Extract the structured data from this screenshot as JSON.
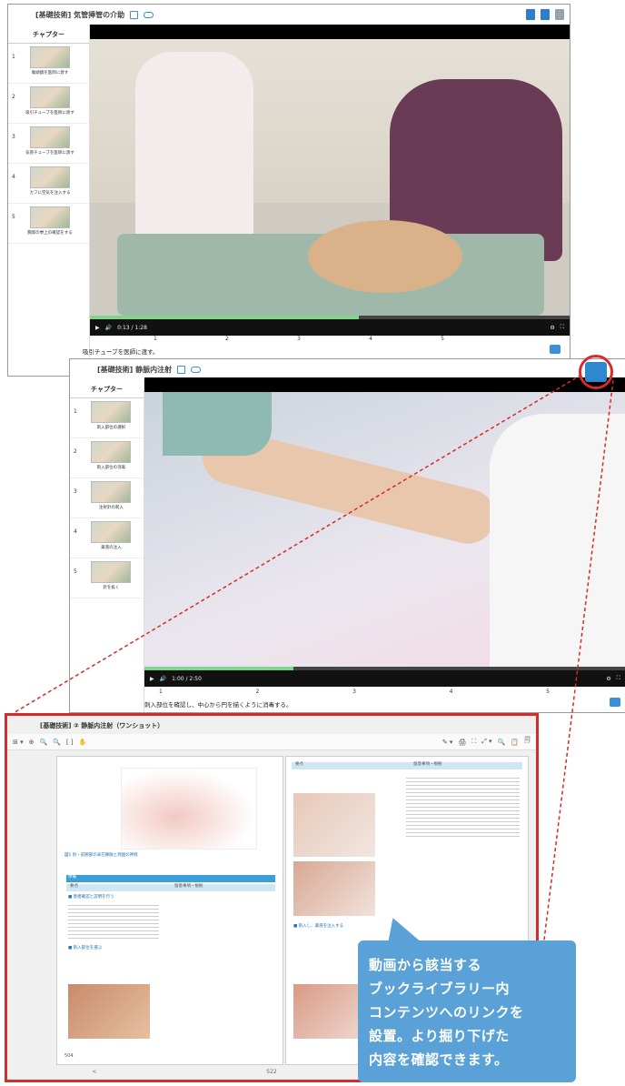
{
  "window1": {
    "title": "[基礎技術] 気管挿管の介助",
    "chapter_header": "チャプター",
    "chapters": [
      {
        "num": "1",
        "label": "喉頭鏡を医師に渡す"
      },
      {
        "num": "2",
        "label": "吸引チューブを医師に渡す"
      },
      {
        "num": "3",
        "label": "気管チューブを医師に渡す"
      },
      {
        "num": "4",
        "label": "カフに空気を注入する"
      },
      {
        "num": "5",
        "label": "胸郭の挙上の確認をする"
      }
    ],
    "time": "0:13 / 1:28",
    "ticks": [
      "1",
      "2",
      "3",
      "4",
      "5"
    ],
    "caption": "吸引チューブを医師に渡す。",
    "progress": 0.56
  },
  "window2": {
    "title": "[基礎技術] 静脈内注射",
    "chapter_header": "チャプター",
    "chapters": [
      {
        "num": "1",
        "label": "刺入部位の選択"
      },
      {
        "num": "2",
        "label": "刺入部位の消毒"
      },
      {
        "num": "3",
        "label": "注射針の刺入"
      },
      {
        "num": "4",
        "label": "薬液の注入"
      },
      {
        "num": "5",
        "label": "針を抜く"
      }
    ],
    "time": "1:00 / 2:50",
    "ticks": [
      "1",
      "2",
      "3",
      "4",
      "5"
    ],
    "caption": "刺入部位を確認し、中心から円を描くように消毒する。",
    "progress": 0.31
  },
  "doc": {
    "title": "[基礎技術] ② 静脈内注射（ワンショット）",
    "toolbar_left": [
      "⊞ ▾",
      "⊕",
      "🔍",
      "🔍",
      "[ ]",
      "✋"
    ],
    "toolbar_right": [
      "✎ ▾",
      "🖨",
      "⛶",
      "⤢ ▾",
      "🔍",
      "📋",
      "🗐"
    ],
    "left_page_number": "504",
    "left_figure_caption": "図1 肘・前腕部の表在静脈と周囲の神経",
    "left_section_heading": "準備",
    "left_table_headers": [
      "要点",
      "留意事項・根拠"
    ],
    "left_steps": [
      "■ 患者確認と説明を行う",
      "■ 刺入部位を選ぶ"
    ],
    "right_headers": [
      "要点",
      "留意事項・根拠"
    ],
    "right_step": "■ 刺入し、薬液を注入する",
    "nav_prev": "<",
    "nav_page": "522",
    "nav_next": ">"
  },
  "bubble": {
    "text": "動画から該当する\nブックライブラリー内\nコンテンツへのリンクを\n設置。より掘り下げた\n内容を確認できます。"
  }
}
